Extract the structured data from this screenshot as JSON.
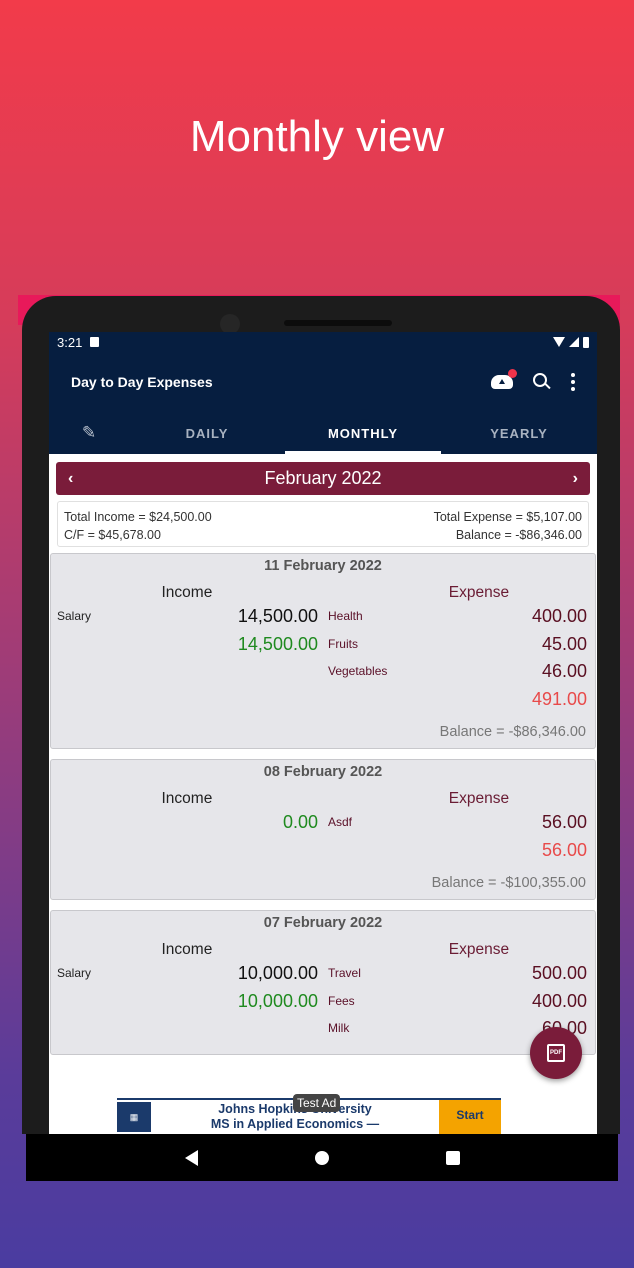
{
  "promo": {
    "title": "Monthly view"
  },
  "status": {
    "time": "3:21"
  },
  "appbar": {
    "title": "Day to Day Expenses"
  },
  "tabs": [
    {
      "label": "DAILY"
    },
    {
      "label": "MONTHLY"
    },
    {
      "label": "YEARLY"
    }
  ],
  "month_nav": {
    "label": "February 2022",
    "prev": "‹",
    "next": "›"
  },
  "summary": {
    "total_income": "Total Income = $24,500.00",
    "cf": "C/F = $45,678.00",
    "total_expense": "Total Expense = $5,107.00",
    "balance": "Balance = -$86,346.00"
  },
  "headings": {
    "income": "Income",
    "expense": "Expense"
  },
  "cards": [
    {
      "date": "11 February 2022",
      "income": [
        {
          "category": "Salary",
          "amount": "14,500.00"
        }
      ],
      "income_total": "14,500.00",
      "expense": [
        {
          "category": "Health",
          "amount": "400.00"
        },
        {
          "category": "Fruits",
          "amount": "45.00"
        },
        {
          "category": "Vegetables",
          "amount": "46.00"
        }
      ],
      "expense_total": "491.00",
      "balance": "Balance = -$86,346.00"
    },
    {
      "date": "08 February 2022",
      "income": [],
      "income_total": "0.00",
      "expense": [
        {
          "category": "Asdf",
          "amount": "56.00"
        }
      ],
      "expense_total": "56.00",
      "balance": "Balance = -$100,355.00"
    },
    {
      "date": "07 February 2022",
      "income": [
        {
          "category": "Salary",
          "amount": "10,000.00"
        }
      ],
      "income_total": "10,000.00",
      "expense": [
        {
          "category": "Travel",
          "amount": "500.00"
        },
        {
          "category": "Fees",
          "amount": "400.00"
        },
        {
          "category": "Milk",
          "amount": "60.00"
        }
      ]
    }
  ],
  "ad": {
    "label": "Test Ad",
    "line1": "Johns Hopkins University",
    "line2": "MS in Applied Economics —",
    "cta": "Start"
  },
  "colors": {
    "appbar": "#061e40",
    "accent": "#7a1c3a",
    "income_total": "#1f8a1f",
    "expense_total": "#e84a4a"
  }
}
